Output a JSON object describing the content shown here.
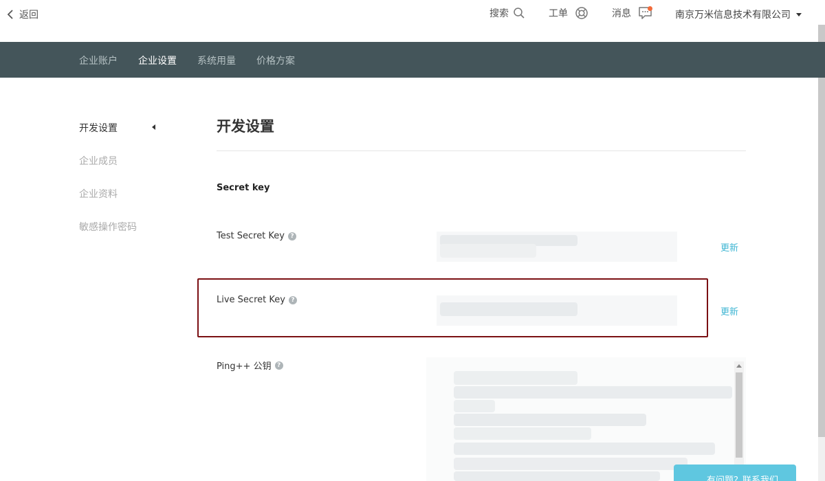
{
  "header": {
    "back_label": "返回",
    "search_label": "搜索",
    "ticket_label": "工单",
    "message_label": "消息",
    "company_name": "南京万米信息技术有限公司"
  },
  "nav": {
    "tabs": [
      {
        "label": "企业账户"
      },
      {
        "label": "企业设置",
        "active": true
      },
      {
        "label": "系统用量"
      },
      {
        "label": "价格方案"
      }
    ]
  },
  "sidebar": {
    "items": [
      {
        "label": "开发设置",
        "active": true
      },
      {
        "label": "企业成员"
      },
      {
        "label": "企业资料"
      },
      {
        "label": "敏感操作密码"
      }
    ]
  },
  "main": {
    "title": "开发设置",
    "section_title": "Secret key",
    "test_key_label": "Test Secret Key",
    "live_key_label": "Live Secret Key",
    "pubkey_label": "Ping++ 公钥",
    "update_label": "更新",
    "help_glyph": "?"
  },
  "contact": {
    "label": "有问题？联系我们"
  },
  "colors": {
    "navbar_bg": "#44555a",
    "link": "#3fb6d3",
    "highlight_border": "#7a0f12",
    "contact_bg": "#5fc7e0",
    "message_dot": "#f26b3a"
  }
}
